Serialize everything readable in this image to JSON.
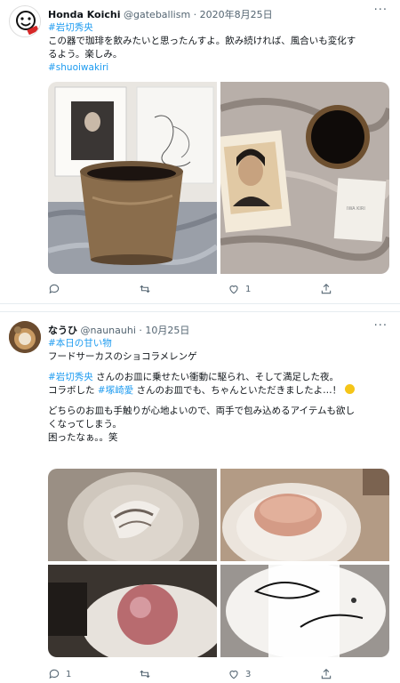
{
  "tweets": [
    {
      "name": "Honda Koichi",
      "handle": "@gateballism",
      "date": "2020年8月25日",
      "hashtag": "#岩切秀央",
      "lines": [
        "この器で珈琲を飲みたいと思ったんすよ。飲み続ければ、風合いも変化す",
        "るよう。楽しみ。"
      ],
      "hashtag2": "#shuoiwakiri",
      "card_text": "IWA KIRI",
      "reply_count": "",
      "retweet_count": "",
      "like_count": "1"
    },
    {
      "name": "なうひ",
      "handle": "@naunauhi",
      "date": "10月25日",
      "hashtag": "#本日の甘い物",
      "title": "フードサーカスのショコラメレンゲ",
      "p1_tag": "#岩切秀央",
      "p1_rest": " さんのお皿に乗せたい衝動に駆られ、そして満足した夜。",
      "p2_pre": "コラボした ",
      "p2_tag": "#塚崎愛",
      "p2_rest": " さんのお皿でも、ちゃんといただきましたよ…！",
      "p3_lines": [
        "どちらのお皿も手触りが心地よいので、両手で包み込めるアイテムも欲し",
        "くなってしまう。",
        "困ったなぁ。。笑"
      ],
      "reply_count": "1",
      "retweet_count": "",
      "like_count": "3"
    }
  ],
  "colors": {
    "link": "#1d9bf0",
    "muted": "#536471",
    "text": "#0f1419"
  },
  "icons": [
    "reply-icon",
    "retweet-icon",
    "like-icon",
    "share-icon",
    "more-icon"
  ]
}
